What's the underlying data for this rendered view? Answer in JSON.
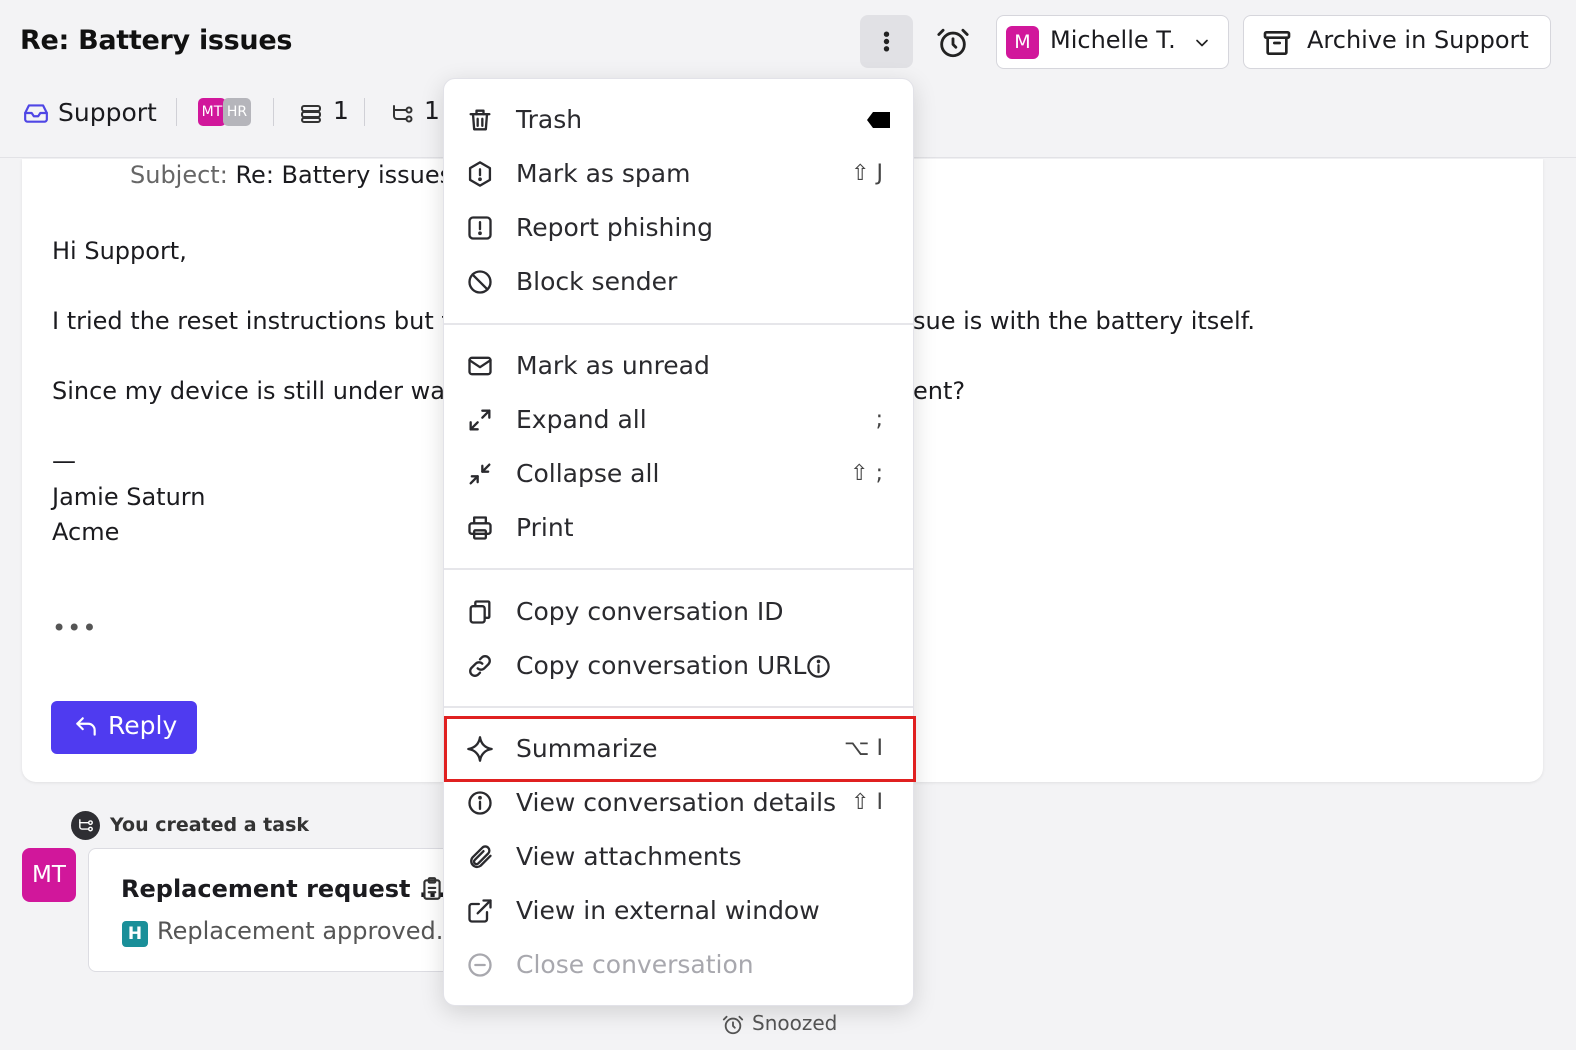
{
  "header": {
    "title": "Re: Battery issues",
    "assignee": {
      "initial": "M",
      "name": "Michelle T.",
      "color": "#d1179b"
    },
    "archive_label": "Archive in Support"
  },
  "subbar": {
    "inbox": "Support",
    "avatars": [
      {
        "initials": "MT",
        "color": "#d1179b"
      },
      {
        "initials": "HR",
        "color": "#b5b5bb"
      }
    ],
    "conversations_count": "1",
    "tasks_count": "1"
  },
  "email": {
    "subject_key": "Subject:",
    "subject_value": "Re: Battery issues",
    "greeting": "Hi Support,",
    "line1_left": "I tried the reset instructions but th",
    "line1_right": "sue is with the battery itself.",
    "line2_left": "Since my device is still under war",
    "line2_right": "ent?",
    "dash": "—",
    "signature_name": "Jamie Saturn",
    "signature_company": "Acme",
    "ellipsis": "•••",
    "reply_label": "Reply"
  },
  "task": {
    "event_text": "You created a task",
    "avatar_initials": "MT",
    "title": "Replacement request ...",
    "badge": "H",
    "note": "Replacement approved."
  },
  "status": {
    "snoozed": "Snoozed"
  },
  "menu": {
    "trash": "Trash",
    "spam": "Mark as spam",
    "spam_shortcut": "⇧ J",
    "phishing": "Report phishing",
    "block": "Block sender",
    "unread": "Mark as unread",
    "expand": "Expand all",
    "expand_shortcut": ";",
    "collapse": "Collapse all",
    "collapse_shortcut": "⇧ ;",
    "print": "Print",
    "copy_id": "Copy conversation ID",
    "copy_url": "Copy conversation URL",
    "summarize": "Summarize",
    "summarize_shortcut": "⌥ I",
    "details": "View conversation details",
    "details_shortcut": "⇧ I",
    "attachments": "View attachments",
    "external": "View in external window",
    "close": "Close conversation",
    "highlight_color": "#e02020"
  },
  "colors": {
    "accent": "#4f3bf0",
    "brand_pink": "#d1179b",
    "teal_badge": "#1a8f99"
  }
}
